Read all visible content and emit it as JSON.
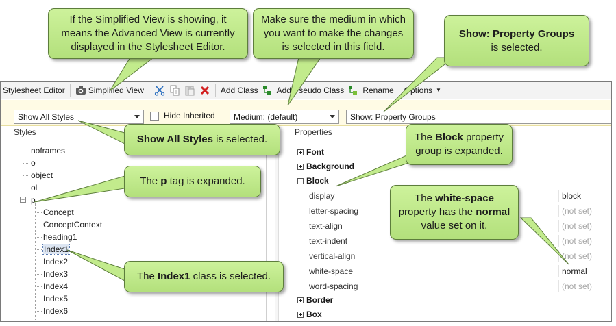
{
  "toolbar": {
    "title": "Stylesheet Editor",
    "simplified_view": "Simplified View",
    "add_class": "Add Class",
    "add_pseudo_class": "Add Pseudo Class",
    "rename": "Rename",
    "options": "Options"
  },
  "filters": {
    "show_styles": "Show All Styles",
    "hide_inherited": "Hide Inherited",
    "medium": "Medium: (default)",
    "show_groups": "Show: Property Groups"
  },
  "styles_pane": {
    "label": "Styles",
    "items": [
      "noframes",
      "o",
      "object",
      "ol",
      "p"
    ],
    "children": [
      "Concept",
      "ConceptContext",
      "heading1",
      "Index1",
      "Index2",
      "Index3",
      "Index4",
      "Index5",
      "Index6"
    ],
    "selected": "Index1"
  },
  "properties_pane": {
    "label": "Properties",
    "groups_top": [
      "Font",
      "Background"
    ],
    "expanded_group": "Block",
    "properties": [
      {
        "name": "display",
        "value": "block"
      },
      {
        "name": "letter-spacing",
        "value": "(not set)"
      },
      {
        "name": "text-align",
        "value": "(not set)"
      },
      {
        "name": "text-indent",
        "value": "(not set)"
      },
      {
        "name": "vertical-align",
        "value": "(not set)"
      },
      {
        "name": "white-space",
        "value": "normal"
      },
      {
        "name": "word-spacing",
        "value": "(not set)"
      }
    ],
    "groups_bottom": [
      "Border",
      "Box"
    ]
  },
  "callouts": {
    "simplified_view": "If the Simplified View is showing, it means the Advanced View is currently displayed in the Stylesheet Editor.",
    "medium": "Make sure the medium in which you want to make the changes is selected in this field.",
    "property_groups": {
      "bold": "Show: Property Groups",
      "rest": "is selected."
    },
    "show_all_styles": {
      "bold": "Show All Styles",
      "rest": "is selected."
    },
    "block_group": {
      "pre": "The",
      "bold": "Block",
      "rest": "property group is expanded."
    },
    "white_space": {
      "pre": "The",
      "bold": "white-space",
      "mid": "property has the",
      "bold2": "normal",
      "rest": "value set on it."
    },
    "p_tag": {
      "pre": "The",
      "bold": "p",
      "rest": "tag is expanded."
    },
    "index1": {
      "pre": "The",
      "bold": "Index1",
      "rest": "class is selected."
    }
  },
  "colors": {
    "callout_fill": "#c2eb8c",
    "callout_border": "#5d7d3c",
    "filter_bar": "#fffbe5",
    "selection": "#dde6f3"
  }
}
